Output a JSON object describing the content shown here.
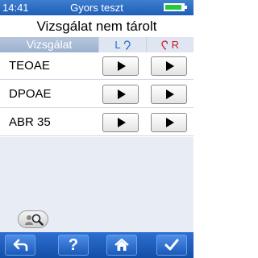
{
  "status": {
    "time": "14:41",
    "app_title": "Gyors teszt",
    "battery_level": 0.9,
    "battery_color": "#27c83a"
  },
  "header": {
    "title": "Vizsgálat nem tárolt"
  },
  "columns": {
    "test": "Vizsgálat",
    "left": "L",
    "right": "R",
    "left_color": "#1c6fd0",
    "right_color": "#c81e2e"
  },
  "tests": [
    {
      "label": "TEOAE"
    },
    {
      "label": "DPOAE"
    },
    {
      "label": "ABR 35"
    }
  ],
  "toolbar": {
    "help_label": "?",
    "icons": [
      "back-arrow-icon",
      "help-icon",
      "home-icon",
      "checkmark-icon"
    ]
  }
}
